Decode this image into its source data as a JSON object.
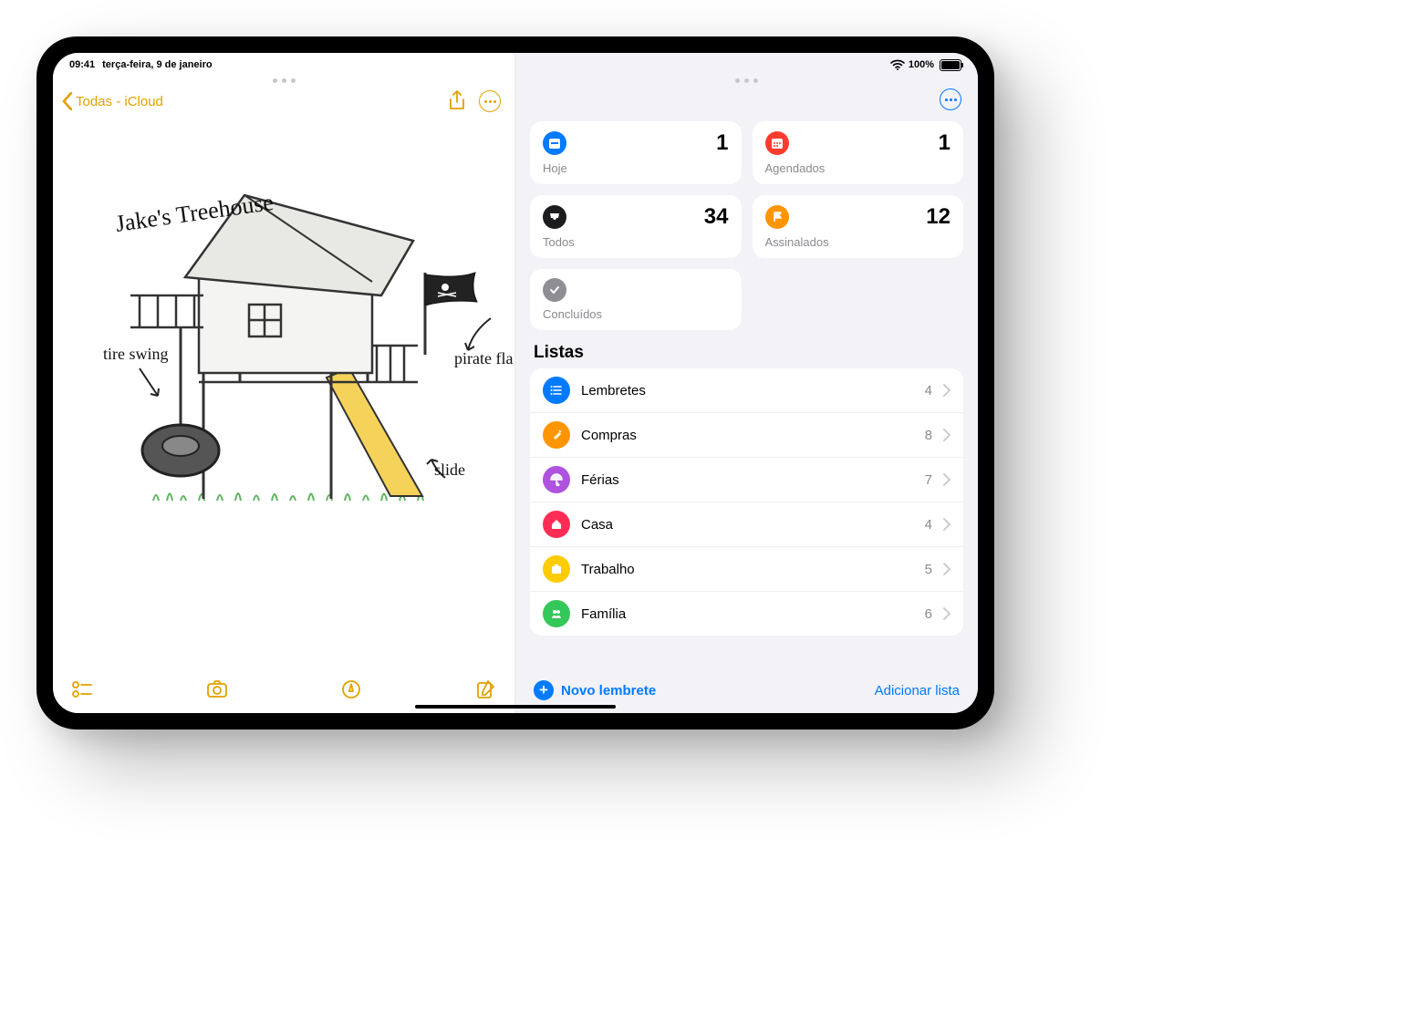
{
  "status": {
    "time": "09:41",
    "date": "terça-feira, 9 de janeiro",
    "battery": "100%"
  },
  "notes": {
    "back_label": "Todas - iCloud",
    "meta_line1": "",
    "meta_line2": "",
    "sketch_title": "Jake's Treehouse",
    "label_tire": "tire swing",
    "label_flag": "pirate flag",
    "label_slide": "slide"
  },
  "reminders": {
    "cards": {
      "today": {
        "label": "Hoje",
        "count": "1"
      },
      "scheduled": {
        "label": "Agendados",
        "count": "1"
      },
      "all": {
        "label": "Todos",
        "count": "34"
      },
      "flagged": {
        "label": "Assinalados",
        "count": "12"
      },
      "done": {
        "label": "Concluídos",
        "count": ""
      }
    },
    "lists_title": "Listas",
    "lists": [
      {
        "name": "Lembretes",
        "count": "4",
        "color": "#007aff",
        "icon": "list"
      },
      {
        "name": "Compras",
        "count": "8",
        "color": "#ff9500",
        "icon": "carrot"
      },
      {
        "name": "Férias",
        "count": "7",
        "color": "#af52de",
        "icon": "umbrella"
      },
      {
        "name": "Casa",
        "count": "4",
        "color": "#ff2d55",
        "icon": "house"
      },
      {
        "name": "Trabalho",
        "count": "5",
        "color": "#ffcc00",
        "icon": "briefcase"
      },
      {
        "name": "Família",
        "count": "6",
        "color": "#34c759",
        "icon": "people"
      }
    ],
    "new_label": "Novo lembrete",
    "add_list_label": "Adicionar lista"
  }
}
